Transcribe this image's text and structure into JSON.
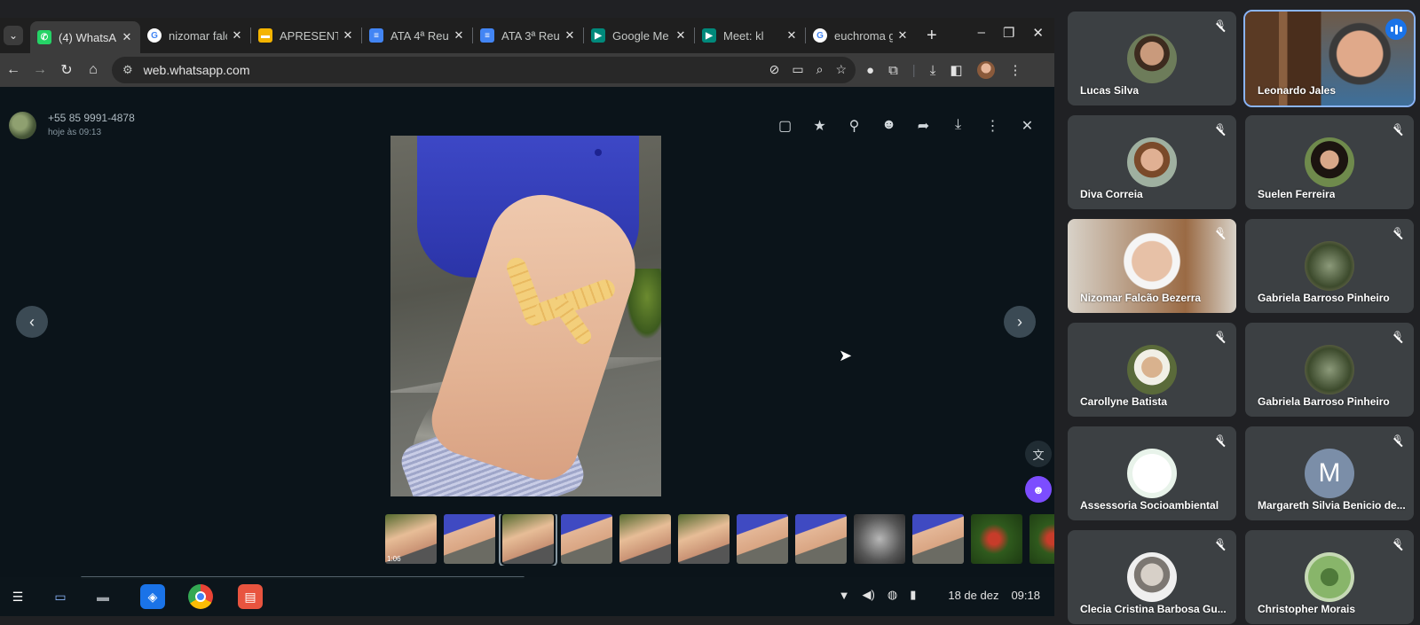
{
  "browser": {
    "tabs": [
      {
        "label": "(4) WhatsA",
        "icon": "whatsapp-icon",
        "color": "#25d366",
        "glyph": "✆",
        "active": true
      },
      {
        "label": "nizomar falc",
        "icon": "google-icon",
        "color": "#ffffff",
        "glyph": "G"
      },
      {
        "label": "APRESENTA",
        "icon": "slides-icon",
        "color": "#f4b400",
        "glyph": "▬"
      },
      {
        "label": "ATA 4ª Reu",
        "icon": "docs-icon",
        "color": "#4285f4",
        "glyph": "≡"
      },
      {
        "label": "ATA 3ª Reu",
        "icon": "docs-icon",
        "color": "#4285f4",
        "glyph": "≡"
      },
      {
        "label": "Google Me",
        "icon": "meet-icon",
        "color": "#00897b",
        "glyph": "▶"
      },
      {
        "label": "Meet: kl",
        "icon": "meet-icon",
        "color": "#00897b",
        "glyph": "▶"
      },
      {
        "label": "euchroma g",
        "icon": "google-icon",
        "color": "#ffffff",
        "glyph": "G"
      }
    ],
    "url": "web.whatsapp.com"
  },
  "viewer": {
    "contact": "+55 85 9991-4878",
    "timestamp": "hoje às 09:13",
    "thumb_video_duration": "1:06"
  },
  "shelf": {
    "date": "18 de dez",
    "time": "09:18"
  },
  "participants": [
    {
      "name": "Lucas Silva",
      "avatar": "photo"
    },
    {
      "name": "Leonardo Jales",
      "avatar": "video",
      "speaking": true
    },
    {
      "name": "Diva Correia",
      "avatar": "photo"
    },
    {
      "name": "Suelen Ferreira",
      "avatar": "photo"
    },
    {
      "name": "Nizomar Falcão Bezerra",
      "avatar": "video"
    },
    {
      "name": "Gabriela Barroso Pinheiro",
      "avatar": "photo"
    },
    {
      "name": "Carollyne Batista",
      "avatar": "photo"
    },
    {
      "name": "Gabriela Barroso Pinheiro",
      "avatar": "photo"
    },
    {
      "name": "Assessoria Socioambiental",
      "avatar": "logo"
    },
    {
      "name": "Margareth Silvia Benicio de...",
      "avatar": "letter",
      "letter": "M"
    },
    {
      "name": "Clecia Cristina Barbosa Gu...",
      "avatar": "photo"
    },
    {
      "name": "Christopher Morais",
      "avatar": "photo"
    }
  ]
}
